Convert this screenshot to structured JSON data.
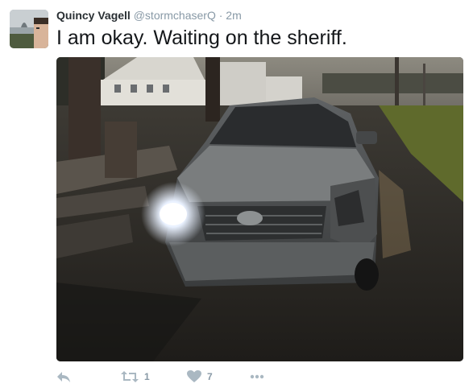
{
  "tweet": {
    "author_name": "Quincy Vagell",
    "handle": "@stormchaserQ",
    "separator": "·",
    "time": "2m",
    "text": "I am okay. Waiting on the sheriff."
  },
  "media": {
    "icon": "photo-of-damaged-car"
  },
  "actions": {
    "reply_icon": "reply-icon",
    "retweet_icon": "retweet-icon",
    "retweet_count": "1",
    "like_icon": "heart-icon",
    "like_count": "7",
    "more_icon": "more-icon"
  },
  "colors": {
    "name": "#292f33",
    "meta": "#8899a6",
    "action_icon": "#aab8c2"
  }
}
